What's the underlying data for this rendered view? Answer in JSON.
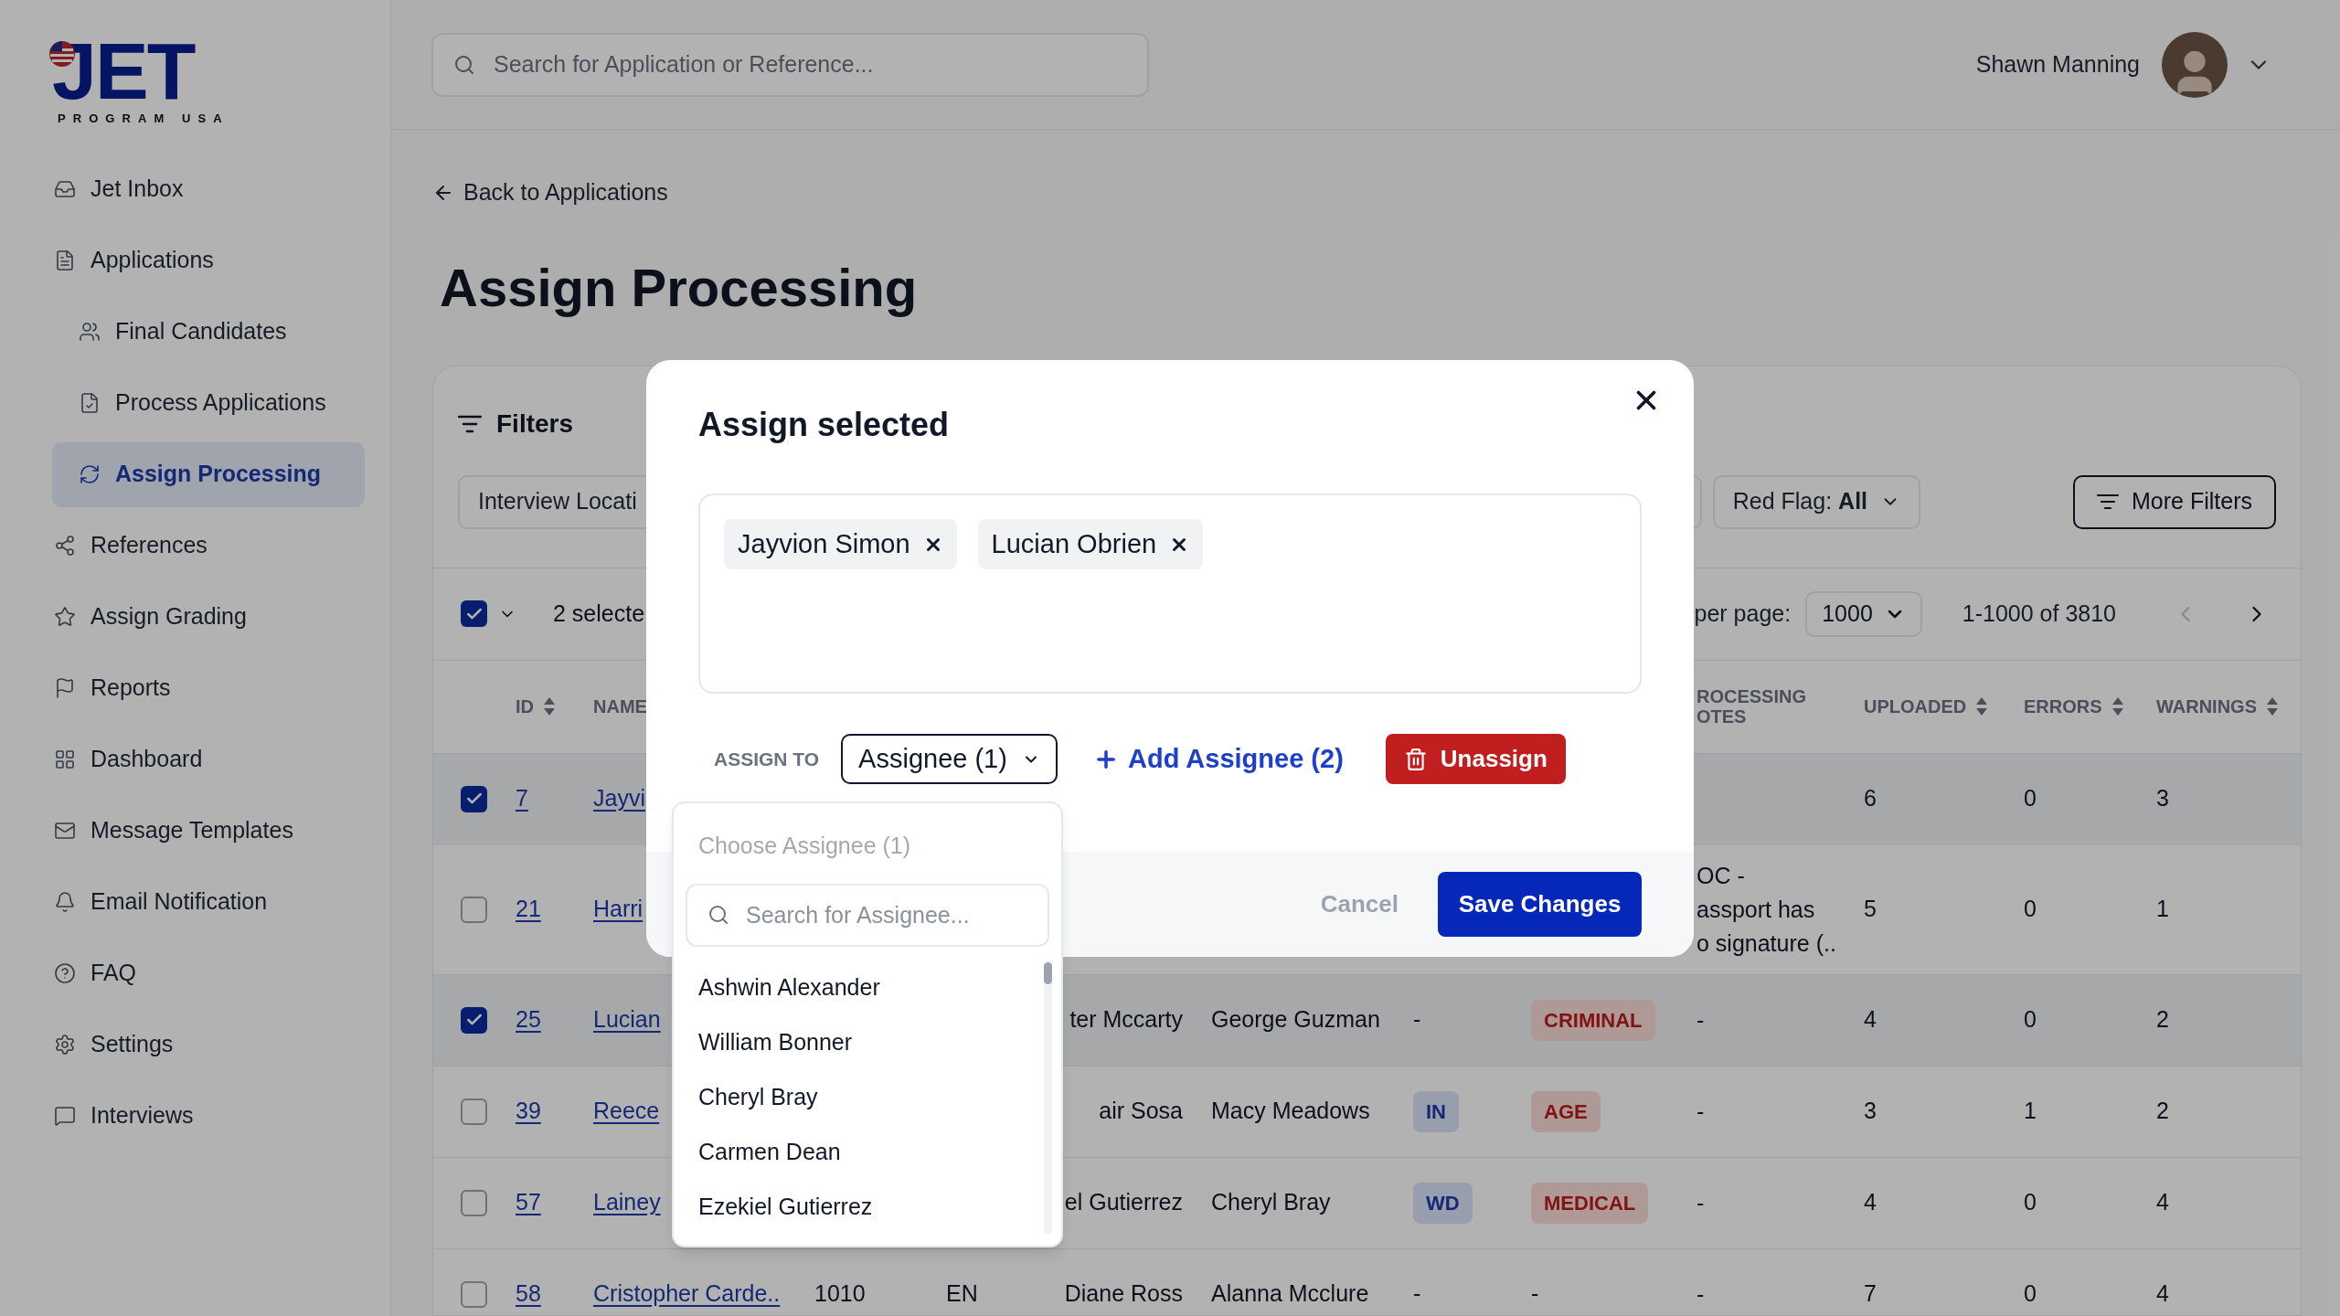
{
  "logo": {
    "word": "JET",
    "tagline": "PROGRAM USA"
  },
  "sidebar": {
    "items": [
      {
        "label": "Jet Inbox",
        "selected": false
      },
      {
        "label": "Applications",
        "selected": false,
        "children": [
          {
            "label": "Final Candidates",
            "selected": false
          },
          {
            "label": "Process Applications",
            "selected": false
          },
          {
            "label": "Assign Processing",
            "selected": true
          }
        ]
      },
      {
        "label": "References",
        "selected": false
      },
      {
        "label": "Assign Grading",
        "selected": false
      },
      {
        "label": "Reports",
        "selected": false
      },
      {
        "label": "Dashboard",
        "selected": false
      },
      {
        "label": "Message Templates",
        "selected": false
      },
      {
        "label": "Email Notification",
        "selected": false
      },
      {
        "label": "FAQ",
        "selected": false
      },
      {
        "label": "Settings",
        "selected": false
      },
      {
        "label": "Interviews",
        "selected": false
      }
    ]
  },
  "header": {
    "search": {
      "placeholder": "Search for Application or Reference..."
    },
    "user": {
      "name": "Shawn Manning"
    }
  },
  "page": {
    "back_link": "Back to Applications",
    "title": "Assign Processing"
  },
  "filters": {
    "title": "Filters",
    "chips": [
      "Interview Locati",
      "Red Flag: **All**"
    ],
    "more_button": "More Filters"
  },
  "toolbar": {
    "select_all_checked": true,
    "selected_text": "2 selecte",
    "per_page_label": "per page:",
    "per_page": "1000",
    "range": "1-1000 of 3810",
    "prev_disabled": true
  },
  "table": {
    "columns": [
      {
        "label": "ID",
        "sortable": true
      },
      {
        "label": "NAME",
        "sortable": false
      },
      {
        "label": "ROCESSING\nOTES",
        "sortable": false
      },
      {
        "label": "UPLOADED",
        "sortable": true
      },
      {
        "label": "ERRORS",
        "sortable": true
      },
      {
        "label": "WARNINGS",
        "sortable": true
      }
    ],
    "rows": [
      {
        "selected": true,
        "id": "7",
        "name": "Jayvi",
        "uploaded": "6",
        "errors": "0",
        "warnings": "3"
      },
      {
        "selected": false,
        "id": "21",
        "name": "Harri",
        "notes": "OC -\nassport has\no signature (..",
        "uploaded": "5",
        "errors": "0",
        "warnings": "1"
      },
      {
        "selected": true,
        "id": "25",
        "name": "Lucian",
        "column_5": "ter Mccarty",
        "column_6": "George Guzman",
        "status": {
          "kind": "plain",
          "text": "-"
        },
        "flag": {
          "kind": "badge",
          "text": "CRIMINAL"
        },
        "notes": "-",
        "uploaded": "4",
        "errors": "0",
        "warnings": "2"
      },
      {
        "selected": false,
        "id": "39",
        "name": "Reece",
        "column_5": "air Sosa",
        "column_6": "Macy Meadows",
        "status": {
          "kind": "badge",
          "text": "IN"
        },
        "flag": {
          "kind": "badge",
          "text": "AGE"
        },
        "notes": "-",
        "uploaded": "3",
        "errors": "1",
        "warnings": "2"
      },
      {
        "selected": false,
        "id": "57",
        "name": "Lainey",
        "column_5": "el Gutierrez",
        "column_6": "Cheryl Bray",
        "status": {
          "kind": "badge",
          "text": "WD"
        },
        "flag": {
          "kind": "badge",
          "text": "MEDICAL"
        },
        "notes": "-",
        "uploaded": "4",
        "errors": "0",
        "warnings": "4"
      },
      {
        "selected": false,
        "id": "58",
        "name": "Cristopher Carde..",
        "column_3": "1010",
        "column_4": "EN",
        "column_5": "Diane Ross",
        "column_6": "Alanna Mcclure",
        "status": {
          "kind": "plain",
          "text": "-"
        },
        "flag": {
          "kind": "plain",
          "text": "-"
        },
        "notes": "-",
        "uploaded": "7",
        "errors": "0",
        "warnings": "4"
      }
    ]
  },
  "modal": {
    "title": "Assign selected",
    "chips": [
      "Jayvion Simon",
      "Lucian Obrien"
    ],
    "assign_label": "ASSIGN TO",
    "assignee_select": "Assignee (1)",
    "add_link": "Add Assignee (2)",
    "unassign": "Unassign",
    "cancel": "Cancel",
    "save": "Save Changes"
  },
  "dropdown": {
    "heading": "Choose Assignee (1)",
    "search_placeholder": "Search for Assignee...",
    "options": [
      "Ashwin Alexander",
      "William Bonner",
      "Cheryl Bray",
      "Carmen Dean",
      "Ezekiel Gutierrez"
    ]
  }
}
